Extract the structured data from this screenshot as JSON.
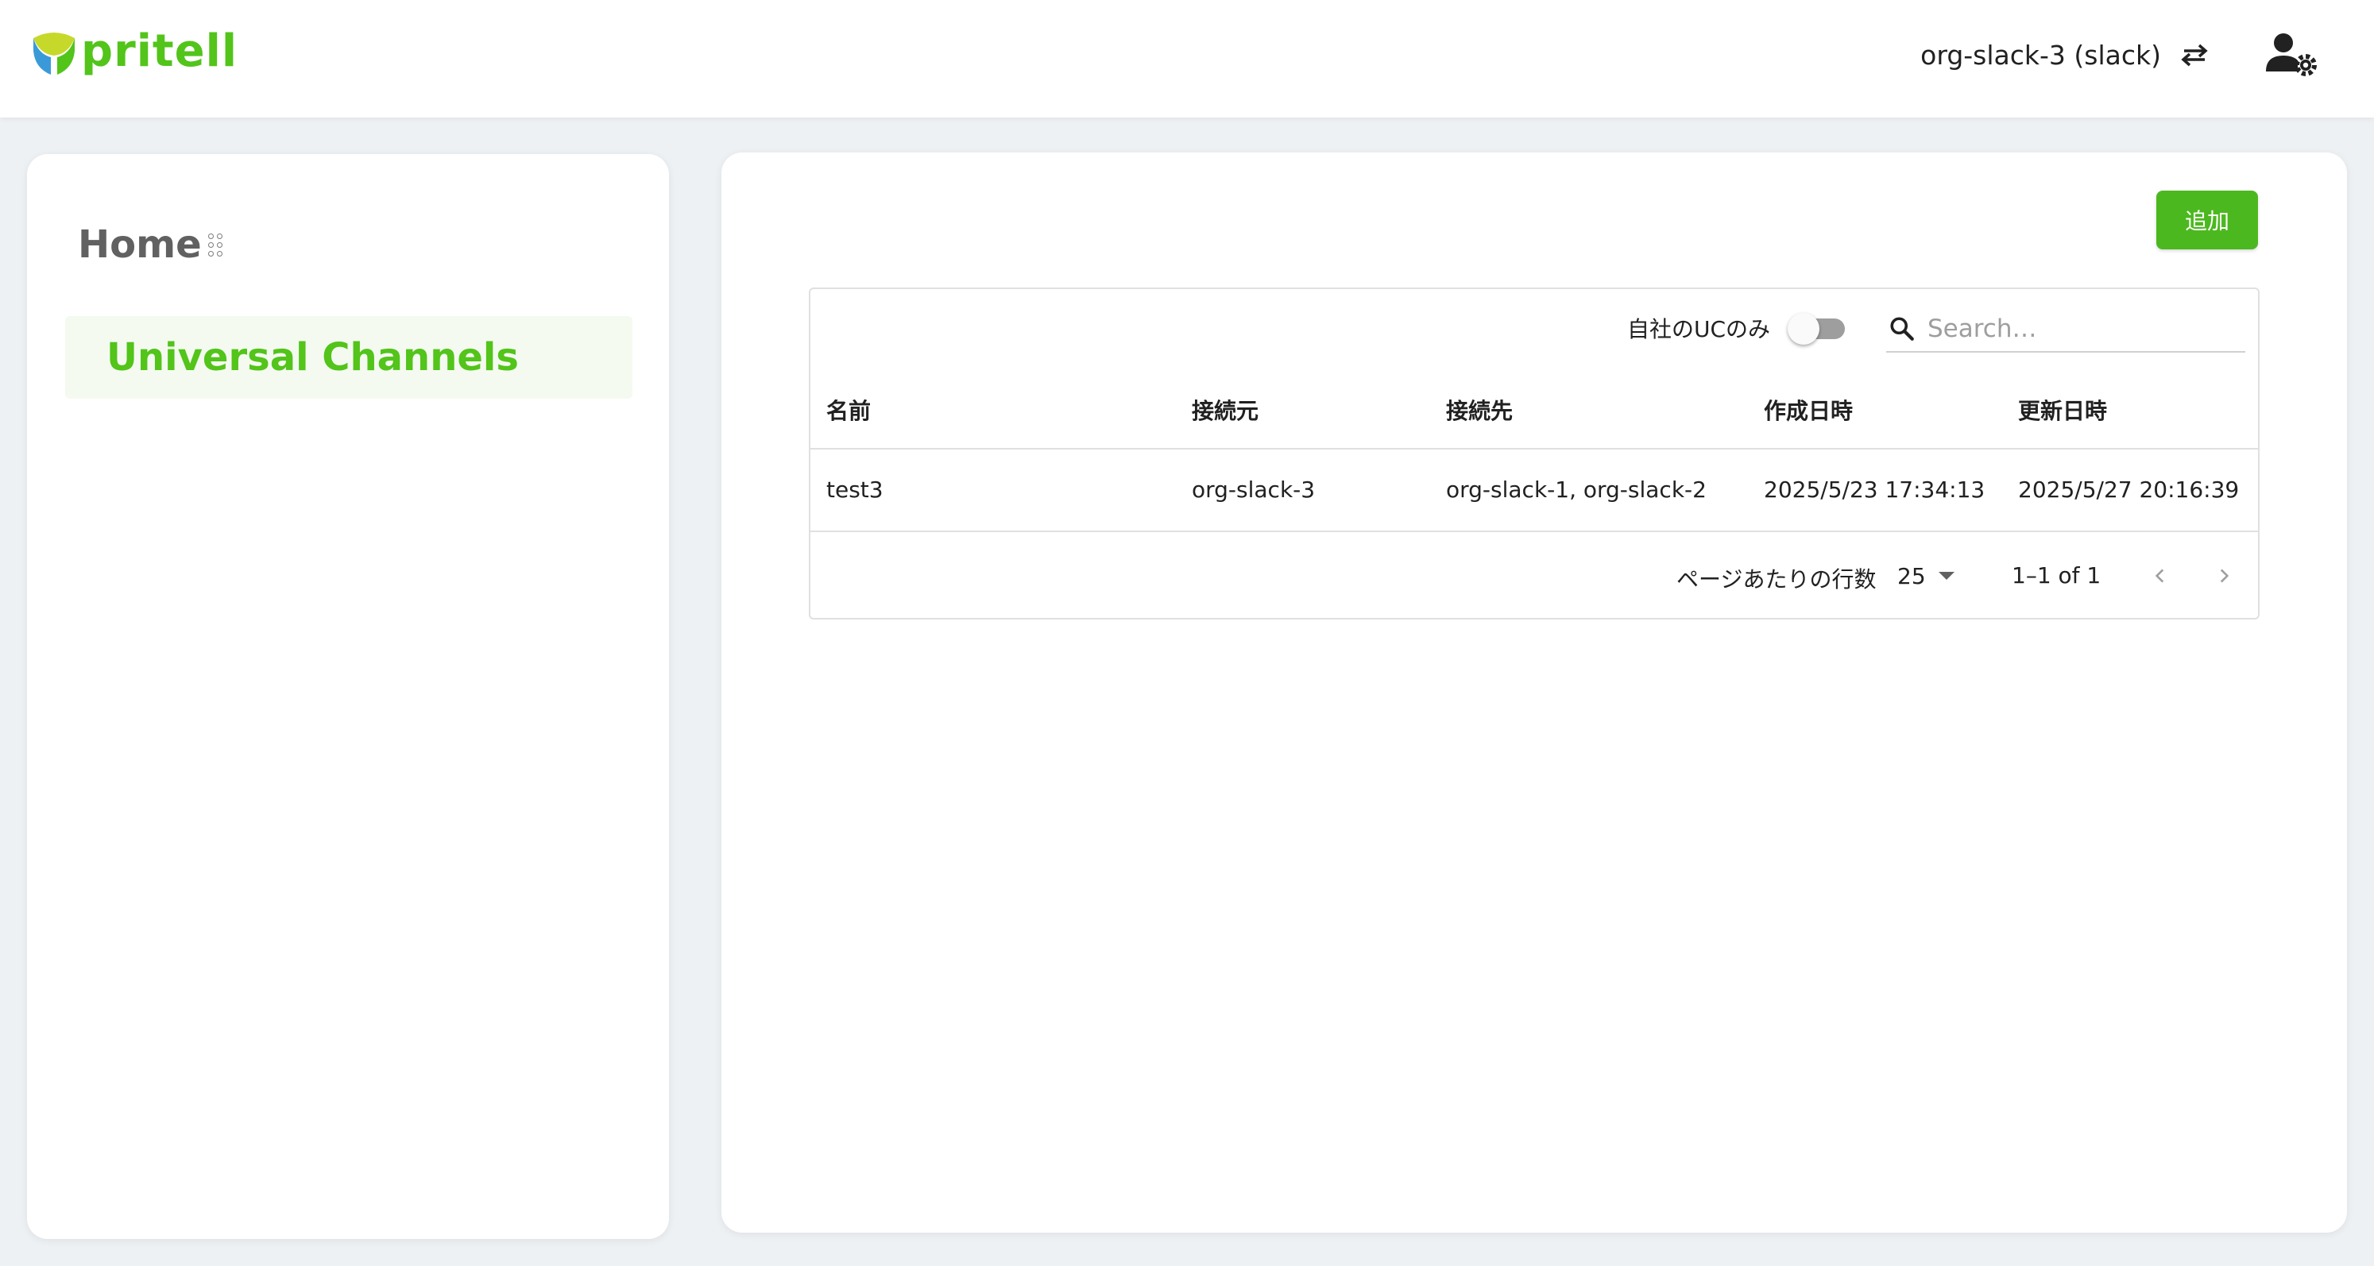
{
  "colors": {
    "brand_green": "#52c41a",
    "logo_yellow": "#c6d92a",
    "logo_blue": "#3a9ad9",
    "button_green": "#4cb81f",
    "nav_active_text": "#52c41a"
  },
  "header": {
    "logo_text": "pritell",
    "org_label": "org-slack-3 (slack)",
    "icons": {
      "switch": "swap-arrows-icon",
      "user_settings": "user-settings-icon"
    }
  },
  "sidebar": {
    "items": [
      {
        "label": "Home",
        "icon": "grip-dots-icon",
        "active": false
      },
      {
        "label": "Universal Channels",
        "active": true
      }
    ]
  },
  "main": {
    "add_button": "追加",
    "filter": {
      "toggle_label": "自社のUCのみ",
      "toggle_on": false
    },
    "search": {
      "placeholder": "Search…",
      "icon": "search-icon"
    },
    "table": {
      "columns": [
        "名前",
        "接続元",
        "接続先",
        "作成日時",
        "更新日時"
      ],
      "rows": [
        [
          "test3",
          "org-slack-3",
          "org-slack-1, org-slack-2",
          "2025/5/23 17:34:13",
          "2025/5/27 20:16:39"
        ]
      ]
    },
    "pagination": {
      "rows_per_page_label": "ページあたりの行数",
      "rows_per_page": "25",
      "range": "1–1 of 1",
      "icons": {
        "prev": "chevron-left-icon",
        "next": "chevron-right-icon"
      }
    }
  }
}
